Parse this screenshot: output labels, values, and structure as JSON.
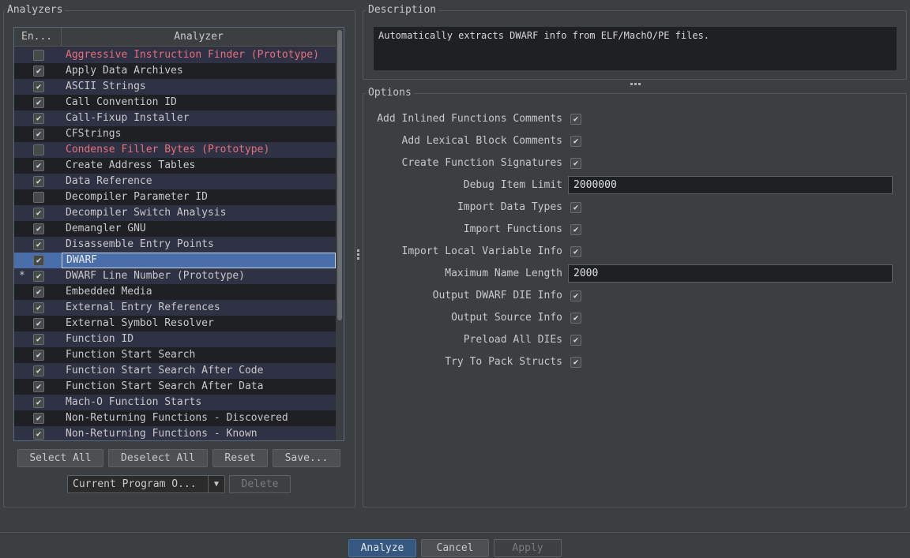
{
  "analyzers_panel": {
    "title": "Analyzers",
    "columns": {
      "enabled": "En...",
      "analyzer": "Analyzer"
    },
    "rows": [
      {
        "name": "Aggressive Instruction Finder (Prototype)",
        "checked": false,
        "prototype": true,
        "star": "",
        "selected": false
      },
      {
        "name": "Apply Data Archives",
        "checked": true,
        "prototype": false,
        "star": "",
        "selected": false
      },
      {
        "name": "ASCII Strings",
        "checked": true,
        "prototype": false,
        "star": "",
        "selected": false
      },
      {
        "name": "Call Convention ID",
        "checked": true,
        "prototype": false,
        "star": "",
        "selected": false
      },
      {
        "name": "Call-Fixup Installer",
        "checked": true,
        "prototype": false,
        "star": "",
        "selected": false
      },
      {
        "name": "CFStrings",
        "checked": true,
        "prototype": false,
        "star": "",
        "selected": false
      },
      {
        "name": "Condense Filler Bytes (Prototype)",
        "checked": false,
        "prototype": true,
        "star": "",
        "selected": false
      },
      {
        "name": "Create Address Tables",
        "checked": true,
        "prototype": false,
        "star": "",
        "selected": false
      },
      {
        "name": "Data Reference",
        "checked": true,
        "prototype": false,
        "star": "",
        "selected": false
      },
      {
        "name": "Decompiler Parameter ID",
        "checked": false,
        "prototype": false,
        "star": "",
        "selected": false
      },
      {
        "name": "Decompiler Switch Analysis",
        "checked": true,
        "prototype": false,
        "star": "",
        "selected": false
      },
      {
        "name": "Demangler GNU",
        "checked": true,
        "prototype": false,
        "star": "",
        "selected": false
      },
      {
        "name": "Disassemble Entry Points",
        "checked": true,
        "prototype": false,
        "star": "",
        "selected": false
      },
      {
        "name": "DWARF",
        "checked": true,
        "prototype": false,
        "star": "",
        "selected": true
      },
      {
        "name": "DWARF Line Number (Prototype)",
        "checked": true,
        "prototype": false,
        "star": "*",
        "selected": false
      },
      {
        "name": "Embedded Media",
        "checked": true,
        "prototype": false,
        "star": "",
        "selected": false
      },
      {
        "name": "External Entry References",
        "checked": true,
        "prototype": false,
        "star": "",
        "selected": false
      },
      {
        "name": "External Symbol Resolver",
        "checked": true,
        "prototype": false,
        "star": "",
        "selected": false
      },
      {
        "name": "Function ID",
        "checked": true,
        "prototype": false,
        "star": "",
        "selected": false
      },
      {
        "name": "Function Start Search",
        "checked": true,
        "prototype": false,
        "star": "",
        "selected": false
      },
      {
        "name": "Function Start Search After Code",
        "checked": true,
        "prototype": false,
        "star": "",
        "selected": false
      },
      {
        "name": "Function Start Search After Data",
        "checked": true,
        "prototype": false,
        "star": "",
        "selected": false
      },
      {
        "name": "Mach-O Function Starts",
        "checked": true,
        "prototype": false,
        "star": "",
        "selected": false
      },
      {
        "name": "Non-Returning Functions - Discovered",
        "checked": true,
        "prototype": false,
        "star": "",
        "selected": false
      },
      {
        "name": "Non-Returning Functions - Known",
        "checked": true,
        "prototype": false,
        "star": "",
        "selected": false
      }
    ],
    "buttons": {
      "select_all": "Select All",
      "deselect_all": "Deselect All",
      "reset": "Reset",
      "save": "Save..."
    },
    "program_options": "Current Program O...",
    "delete": "Delete"
  },
  "description": {
    "title": "Description",
    "text": "Automatically extracts DWARF info from ELF/MachO/PE files."
  },
  "options": {
    "title": "Options",
    "items": [
      {
        "label": "Add Inlined Functions Comments",
        "type": "checkbox",
        "checked": true
      },
      {
        "label": "Add Lexical Block Comments",
        "type": "checkbox",
        "checked": true
      },
      {
        "label": "Create Function Signatures",
        "type": "checkbox",
        "checked": true
      },
      {
        "label": "Debug Item Limit",
        "type": "text",
        "value": "2000000"
      },
      {
        "label": "Import Data Types",
        "type": "checkbox",
        "checked": true
      },
      {
        "label": "Import Functions",
        "type": "checkbox",
        "checked": true
      },
      {
        "label": "Import Local Variable Info",
        "type": "checkbox",
        "checked": true
      },
      {
        "label": "Maximum Name Length",
        "type": "text",
        "value": "2000"
      },
      {
        "label": "Output DWARF DIE Info",
        "type": "checkbox",
        "checked": true
      },
      {
        "label": "Output Source Info",
        "type": "checkbox",
        "checked": true
      },
      {
        "label": "Preload All DIEs",
        "type": "checkbox",
        "checked": true
      },
      {
        "label": "Try To Pack Structs",
        "type": "checkbox",
        "checked": true
      }
    ]
  },
  "footer": {
    "analyze": "Analyze",
    "cancel": "Cancel",
    "apply": "Apply"
  },
  "colors": {
    "background": "#3c3f41",
    "prototype_text": "#e86e7a",
    "selection": "#4a6ea9",
    "primary_button": "#365880"
  }
}
